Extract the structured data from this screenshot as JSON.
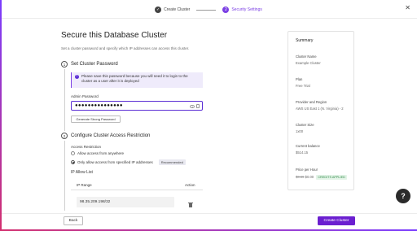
{
  "stepper": {
    "step1_label": "Create Cluster",
    "step1_icon": "check-icon",
    "step2_number": "2",
    "step2_label": "Security Settings"
  },
  "header": {
    "close_icon": "close-icon"
  },
  "page": {
    "title": "Secure this Database Cluster",
    "description": "Set a cluster password and specify which IP addresses can access this cluster."
  },
  "section1": {
    "number": "1",
    "title": "Set Cluster Password",
    "info_text": "Please save this password because you will need it to login to the cluster as a user after it is deployed",
    "password_label": "Admin Password",
    "password_value": "●●●●●●●●●●●●●●●",
    "generate_label": "Generate Strong Password"
  },
  "section2": {
    "number": "2",
    "title": "Configure Cluster Access Restriction",
    "access_label": "Access Restriction",
    "option1": "Allow access from anywhere",
    "option2": "Only allow access from specified IP addresses",
    "recommended": "Recommended",
    "allow_list_title": "IP Allow List",
    "col_ip": "IP Range",
    "col_action": "Action",
    "ip_value": "98.35.209.198/32"
  },
  "summary": {
    "title": "Summary",
    "cluster_name_label": "Cluster Name",
    "cluster_name_value": "Example Cluster",
    "plan_label": "Plan",
    "plan_value": "Free Trial",
    "provider_label": "Provider and Region",
    "provider_value": "AWS US East 1 (N. Virginia) - 2",
    "size_label": "Cluster Size",
    "size_value": "1x00",
    "balance_label": "Current balance",
    "balance_value": "$514.15",
    "price_label": "Price per Hour",
    "price_old": "$0.69",
    "price_new": "$0.00",
    "credit_badge": "CREDITS APPLIED"
  },
  "footer": {
    "back_label": "Back",
    "create_label": "Create Cluster"
  },
  "help": {
    "label": "?"
  },
  "colors": {
    "accent": "#7b3fe4",
    "primary_button": "#6b1fd0",
    "info_bg": "#efebfb",
    "credit_green": "#2f8a47"
  }
}
